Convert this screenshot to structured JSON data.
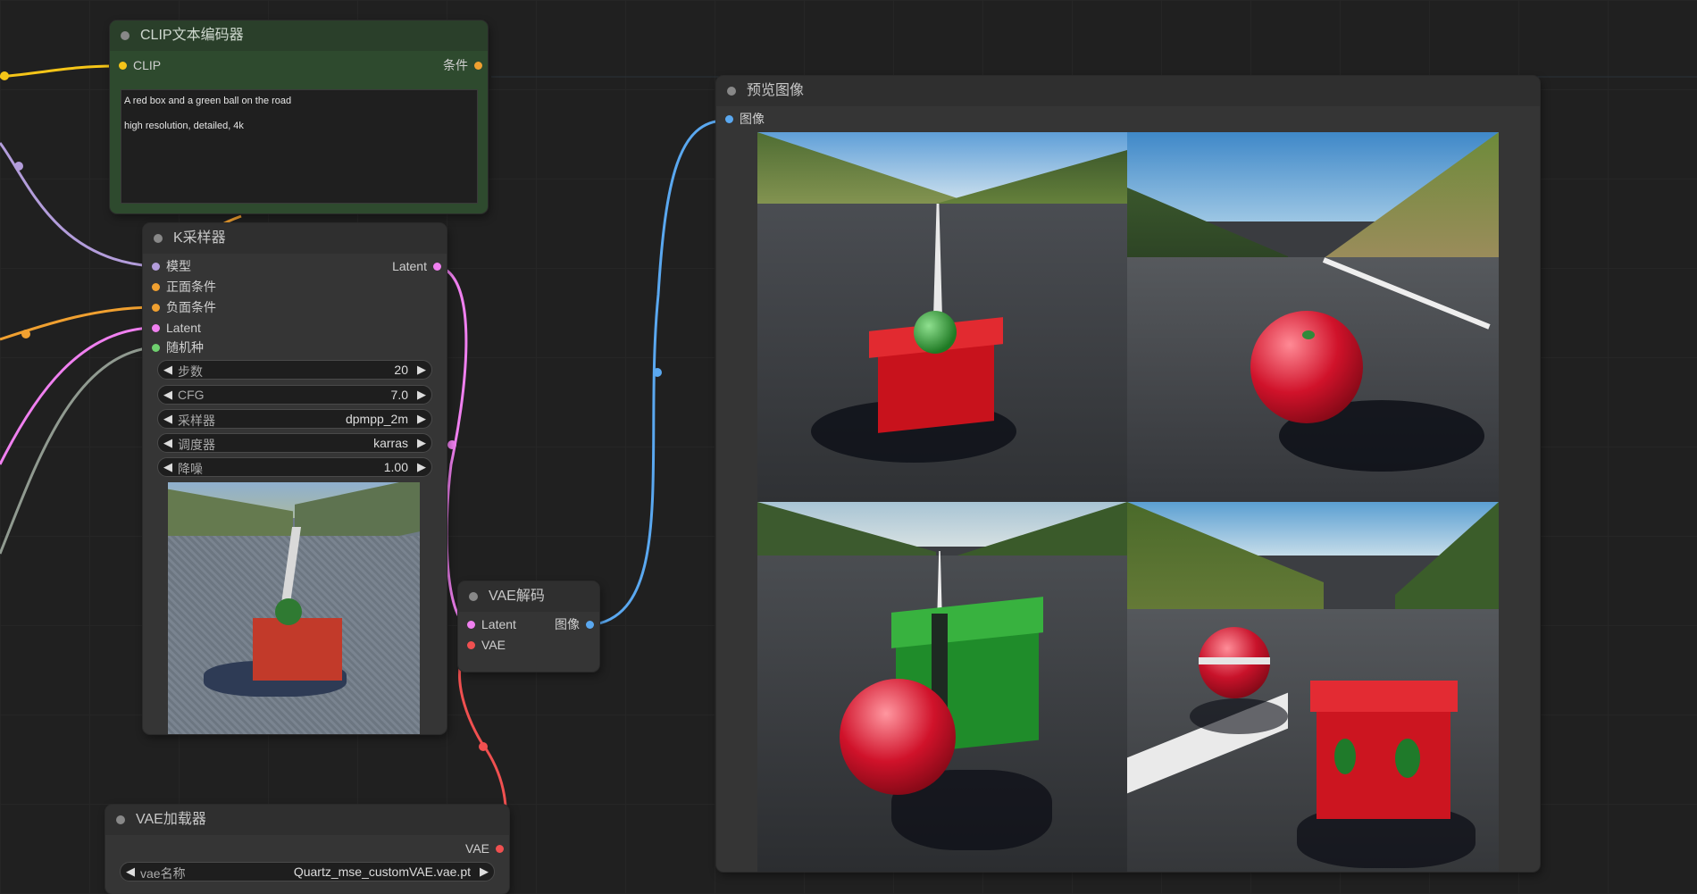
{
  "clip_node": {
    "title": "CLIP文本编码器",
    "input_clip": "CLIP",
    "output_label": "条件",
    "prompt_line1": "A red box and a green ball on the road",
    "prompt_line2": "high resolution, detailed, 4k"
  },
  "ksampler_node": {
    "title": "K采样器",
    "inputs": [
      "模型",
      "正面条件",
      "负面条件",
      "Latent",
      "随机种"
    ],
    "output_label": "Latent",
    "widgets": [
      {
        "label": "步数",
        "value": "20"
      },
      {
        "label": "CFG",
        "value": "7.0"
      },
      {
        "label": "采样器",
        "value": "dpmpp_2m"
      },
      {
        "label": "调度器",
        "value": "karras"
      },
      {
        "label": "降噪",
        "value": "1.00"
      }
    ]
  },
  "vae_decode_node": {
    "title": "VAE解码",
    "input_latent": "Latent",
    "input_vae": "VAE",
    "output_label": "图像"
  },
  "vae_loader_node": {
    "title": "VAE加载器",
    "output_label": "VAE",
    "widget_label": "vae名称",
    "widget_value": "Quartz_mse_customVAE.vae.pt"
  },
  "preview_node": {
    "title": "预览图像",
    "input_label": "图像"
  },
  "colors": {
    "clip": "#f5c518",
    "model": "#b39ddb",
    "conditioning": "#f0a030",
    "latent": "#f080f0",
    "seed": "#6fd06f",
    "vae": "#f05050",
    "image": "#5aa8f0"
  }
}
